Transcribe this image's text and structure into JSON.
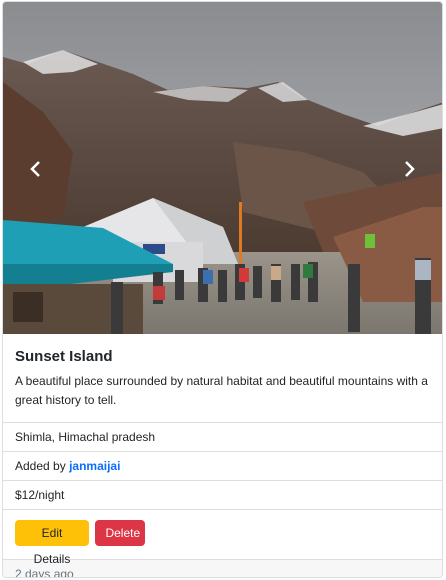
{
  "campground": {
    "title": "Sunset Island",
    "description": "A beautiful place surrounded by natural habitat and beautiful mountains with a great history to tell.",
    "location": "Shimla, Himachal pradesh",
    "added_by_label": "Added by",
    "author": "janmaijai",
    "price": "$12/night",
    "posted": "2 days ago"
  },
  "actions": {
    "edit_label": "Edit Details",
    "delete_label": "Delete"
  },
  "carousel": {
    "prev_icon": "chevron-left-icon",
    "next_icon": "chevron-right-icon"
  },
  "colors": {
    "warning": "#ffc107",
    "danger": "#dc3545",
    "link": "#0d6efd"
  }
}
